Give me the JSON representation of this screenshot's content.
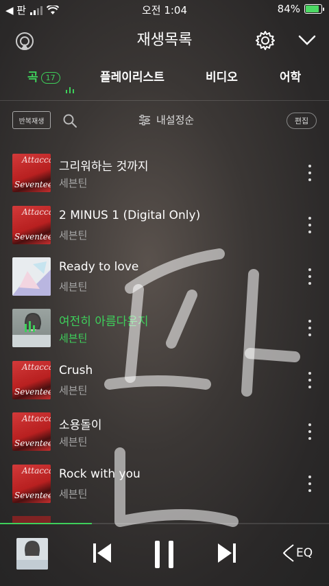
{
  "status_bar": {
    "back_app": "◀ 판",
    "time": "오전 1:04",
    "battery": "84%"
  },
  "header": {
    "title": "재생목록",
    "icons": [
      "cast-icon",
      "gear-icon",
      "chevron-down-icon"
    ]
  },
  "tabs": [
    {
      "label": "곡",
      "count": "17",
      "active": true
    },
    {
      "label": "플레이리스트"
    },
    {
      "label": "비디오"
    },
    {
      "label": "어학"
    }
  ],
  "toolbar": {
    "repeat_label": "반복재생",
    "sort_label": "내설정순",
    "edit_label": "편집"
  },
  "songs": [
    {
      "title": "그리워하는 것까지",
      "artist": "세븐틴",
      "art": "Attacca"
    },
    {
      "title": "2 MINUS 1 (Digital Only)",
      "artist": "세븐틴",
      "art": "Attacca"
    },
    {
      "title": "Ready to love",
      "artist": "세븐틴",
      "art": "Ready to love"
    },
    {
      "title": "여전히 아름다운지",
      "artist": "세븐틴",
      "art": "photo",
      "playing": true
    },
    {
      "title": "Crush",
      "artist": "세븐틴",
      "art": "Attacca"
    },
    {
      "title": "소용돌이",
      "artist": "세븐틴",
      "art": "Attacca"
    },
    {
      "title": "Rock with you",
      "artist": "세븐틴",
      "art": "Attacca"
    }
  ],
  "album_text": {
    "top": "Attacca",
    "bottom": "Seventeen"
  },
  "player": {
    "progress": 0.28,
    "eq_label": "EQ",
    "icons": [
      "previous-icon",
      "pause-icon",
      "next-icon",
      "eq-icon"
    ]
  },
  "colors": {
    "accent": "#3ed05b",
    "text_secondary": "#a6a6a6"
  }
}
